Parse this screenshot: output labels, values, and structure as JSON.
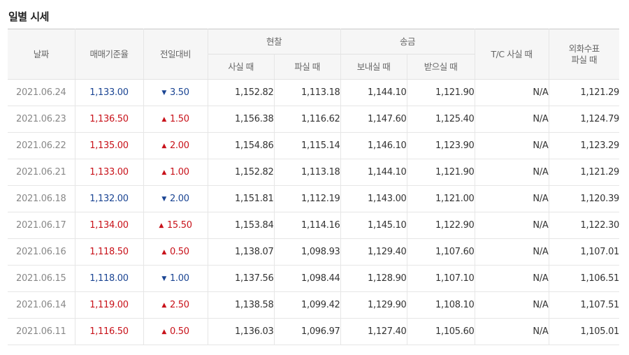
{
  "section": {
    "title": "일별 시세"
  },
  "colors": {
    "up": "#c8121a",
    "down": "#1b4593"
  },
  "icons": {
    "up": "triangle-up-icon",
    "down": "triangle-down-icon"
  },
  "headers": {
    "date": "날짜",
    "base_rate": "매매기준율",
    "change": "전일대비",
    "cash": {
      "label": "현찰",
      "buy": "사실 때",
      "sell": "파실 때"
    },
    "remit": {
      "label": "송금",
      "send": "보내실 때",
      "receive": "받으실 때"
    },
    "tc_buy": "T/C 사실 때",
    "foreign_check_line1": "외화수표",
    "foreign_check_line2": "파실 때"
  },
  "rows": [
    {
      "date": "2021.06.24",
      "base": "1,133.00",
      "dir": "down",
      "arrow": "▼",
      "change": "3.50",
      "cash_buy": "1,152.82",
      "cash_sell": "1,113.18",
      "remit_send": "1,144.10",
      "remit_receive": "1,121.90",
      "tc_buy": "N/A",
      "check_sell": "1,121.29"
    },
    {
      "date": "2021.06.23",
      "base": "1,136.50",
      "dir": "up",
      "arrow": "▲",
      "change": "1.50",
      "cash_buy": "1,156.38",
      "cash_sell": "1,116.62",
      "remit_send": "1,147.60",
      "remit_receive": "1,125.40",
      "tc_buy": "N/A",
      "check_sell": "1,124.79"
    },
    {
      "date": "2021.06.22",
      "base": "1,135.00",
      "dir": "up",
      "arrow": "▲",
      "change": "2.00",
      "cash_buy": "1,154.86",
      "cash_sell": "1,115.14",
      "remit_send": "1,146.10",
      "remit_receive": "1,123.90",
      "tc_buy": "N/A",
      "check_sell": "1,123.29"
    },
    {
      "date": "2021.06.21",
      "base": "1,133.00",
      "dir": "up",
      "arrow": "▲",
      "change": "1.00",
      "cash_buy": "1,152.82",
      "cash_sell": "1,113.18",
      "remit_send": "1,144.10",
      "remit_receive": "1,121.90",
      "tc_buy": "N/A",
      "check_sell": "1,121.29"
    },
    {
      "date": "2021.06.18",
      "base": "1,132.00",
      "dir": "down",
      "arrow": "▼",
      "change": "2.00",
      "cash_buy": "1,151.81",
      "cash_sell": "1,112.19",
      "remit_send": "1,143.00",
      "remit_receive": "1,121.00",
      "tc_buy": "N/A",
      "check_sell": "1,120.39"
    },
    {
      "date": "2021.06.17",
      "base": "1,134.00",
      "dir": "up",
      "arrow": "▲",
      "change": "15.50",
      "cash_buy": "1,153.84",
      "cash_sell": "1,114.16",
      "remit_send": "1,145.10",
      "remit_receive": "1,122.90",
      "tc_buy": "N/A",
      "check_sell": "1,122.30"
    },
    {
      "date": "2021.06.16",
      "base": "1,118.50",
      "dir": "up",
      "arrow": "▲",
      "change": "0.50",
      "cash_buy": "1,138.07",
      "cash_sell": "1,098.93",
      "remit_send": "1,129.40",
      "remit_receive": "1,107.60",
      "tc_buy": "N/A",
      "check_sell": "1,107.01"
    },
    {
      "date": "2021.06.15",
      "base": "1,118.00",
      "dir": "down",
      "arrow": "▼",
      "change": "1.00",
      "cash_buy": "1,137.56",
      "cash_sell": "1,098.44",
      "remit_send": "1,128.90",
      "remit_receive": "1,107.10",
      "tc_buy": "N/A",
      "check_sell": "1,106.51"
    },
    {
      "date": "2021.06.14",
      "base": "1,119.00",
      "dir": "up",
      "arrow": "▲",
      "change": "2.50",
      "cash_buy": "1,138.58",
      "cash_sell": "1,099.42",
      "remit_send": "1,129.90",
      "remit_receive": "1,108.10",
      "tc_buy": "N/A",
      "check_sell": "1,107.51"
    },
    {
      "date": "2021.06.11",
      "base": "1,116.50",
      "dir": "up",
      "arrow": "▲",
      "change": "0.50",
      "cash_buy": "1,136.03",
      "cash_sell": "1,096.97",
      "remit_send": "1,127.40",
      "remit_receive": "1,105.60",
      "tc_buy": "N/A",
      "check_sell": "1,105.01"
    }
  ]
}
